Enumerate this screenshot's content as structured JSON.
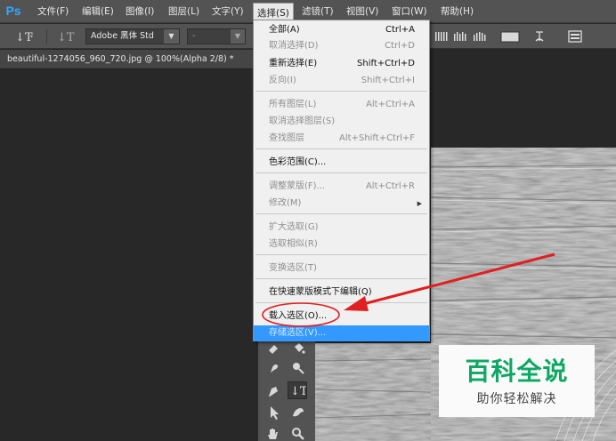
{
  "app": {
    "logo": "Ps",
    "menu": [
      {
        "label": "文件(F)",
        "active": false
      },
      {
        "label": "编辑(E)",
        "active": false
      },
      {
        "label": "图像(I)",
        "active": false
      },
      {
        "label": "图层(L)",
        "active": false
      },
      {
        "label": "文字(Y)",
        "active": false
      },
      {
        "label": "选择(S)",
        "active": true
      },
      {
        "label": "滤镜(T)",
        "active": false
      },
      {
        "label": "视图(V)",
        "active": false
      },
      {
        "label": "窗口(W)",
        "active": false
      },
      {
        "label": "帮助(H)",
        "active": false
      }
    ]
  },
  "options_bar": {
    "font_family": "Adobe 黑体 Std",
    "font_style": "-"
  },
  "document": {
    "tab_title": "beautiful-1274056_960_720.jpg @ 100%(Alpha 2/8) *"
  },
  "select_menu": {
    "items": [
      {
        "label": "全部(A)",
        "shortcut": "Ctrl+A",
        "disabled": false
      },
      {
        "label": "取消选择(D)",
        "shortcut": "Ctrl+D",
        "disabled": true
      },
      {
        "label": "重新选择(E)",
        "shortcut": "Shift+Ctrl+D",
        "disabled": false
      },
      {
        "label": "反向(I)",
        "shortcut": "Shift+Ctrl+I",
        "disabled": true
      },
      {
        "label": "所有图层(L)",
        "shortcut": "Alt+Ctrl+A",
        "disabled": true
      },
      {
        "label": "取消选择图层(S)",
        "shortcut": "",
        "disabled": true
      },
      {
        "label": "查找图层",
        "shortcut": "Alt+Shift+Ctrl+F",
        "disabled": true
      },
      {
        "label": "色彩范围(C)...",
        "shortcut": "",
        "disabled": false
      },
      {
        "label": "调整蒙版(F)...",
        "shortcut": "Alt+Ctrl+R",
        "disabled": true
      },
      {
        "label": "修改(M)",
        "shortcut": "",
        "disabled": true,
        "submenu": true
      },
      {
        "label": "扩大选取(G)",
        "shortcut": "",
        "disabled": true
      },
      {
        "label": "选取相似(R)",
        "shortcut": "",
        "disabled": true
      },
      {
        "label": "变换选区(T)",
        "shortcut": "",
        "disabled": true
      },
      {
        "label": "在快速蒙版模式下编辑(Q)",
        "shortcut": "",
        "disabled": false
      },
      {
        "label": "载入选区(O)...",
        "shortcut": "",
        "disabled": false
      },
      {
        "label": "存储选区(V)...",
        "shortcut": "",
        "disabled": true,
        "highlighted": true
      }
    ]
  },
  "watermark": {
    "title": "百科全说",
    "subtitle": "助你轻松解决"
  },
  "colors": {
    "menu_highlight": "#3399ff",
    "annotation_red": "#e02020",
    "watermark_green": "#0da863"
  }
}
